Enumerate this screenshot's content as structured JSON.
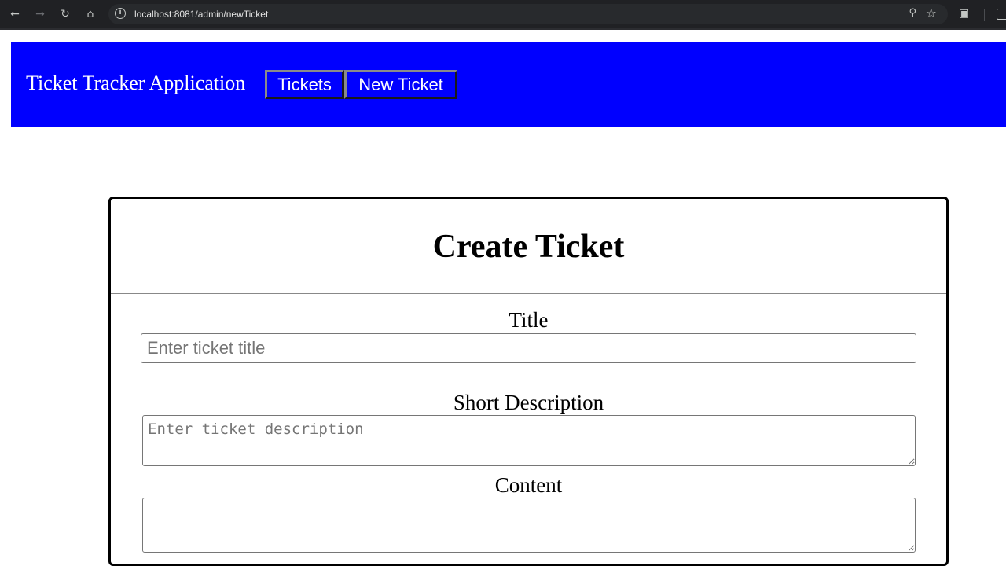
{
  "browser": {
    "back_icon": "arrow-left-icon",
    "forward_icon": "arrow-right-icon",
    "reload_icon": "reload-icon",
    "home_icon": "home-icon",
    "url": "localhost:8081/admin/newTicket",
    "zoom_icon": "zoom-icon",
    "bookmark_icon": "star-icon",
    "extensions_icon": "puzzle-icon",
    "side_panel_icon": "side-panel-icon"
  },
  "header": {
    "background_color": "#0000ff",
    "title": "Ticket Tracker Application",
    "nav": [
      {
        "label": "Tickets"
      },
      {
        "label": "New Ticket"
      }
    ]
  },
  "form": {
    "heading": "Create Ticket",
    "title_label": "Title",
    "title_placeholder": "Enter ticket title",
    "title_value": "",
    "short_description_label": "Short Description",
    "short_description_placeholder": "Enter ticket description",
    "short_description_value": "",
    "content_label": "Content",
    "content_value": ""
  }
}
